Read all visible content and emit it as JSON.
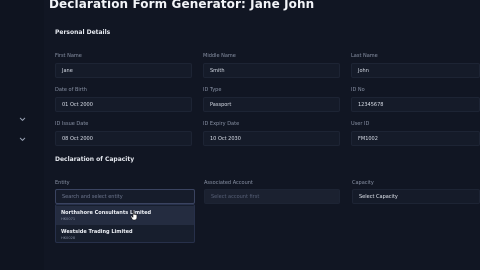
{
  "page": {
    "title": "Declaration Form Generator: Jane John"
  },
  "personal": {
    "section_title": "Personal Details",
    "first_name": {
      "label": "First Name",
      "value": "Jane"
    },
    "middle_name": {
      "label": "Middle Name",
      "value": "Smith"
    },
    "last_name": {
      "label": "Last Name",
      "value": "John"
    },
    "dob": {
      "label": "Date of Birth",
      "value": "01 Oct 2000"
    },
    "id_type": {
      "label": "ID Type",
      "value": "Passport"
    },
    "id_no": {
      "label": "ID No",
      "value": "12345678"
    },
    "id_issue": {
      "label": "ID Issue Date",
      "value": "08 Oct 2000"
    },
    "id_expiry": {
      "label": "ID Expiry Date",
      "value": "10 Oct 2030"
    },
    "user_id": {
      "label": "User ID",
      "value": "FM1002"
    }
  },
  "capacity": {
    "section_title": "Declaration of Capacity",
    "entity": {
      "label": "Entity",
      "placeholder": "Search and select entity"
    },
    "associated_account": {
      "label": "Associated Account",
      "placeholder": "Select account first"
    },
    "capacity": {
      "label": "Capacity",
      "value": "Select Capacity"
    }
  },
  "entity_options": [
    {
      "name": "Northshore Consultants Limited",
      "code": "HK0071"
    },
    {
      "name": "Westside Trading Limited",
      "code": "HK0028"
    }
  ],
  "icons": {
    "left_chevrons": [
      "chevron-down-icon",
      "chevron-down-icon"
    ],
    "cursor": "hand-pointer-icon"
  },
  "colors": {
    "background": "#111623",
    "field": "#151b29",
    "highlight": "#242c40"
  }
}
